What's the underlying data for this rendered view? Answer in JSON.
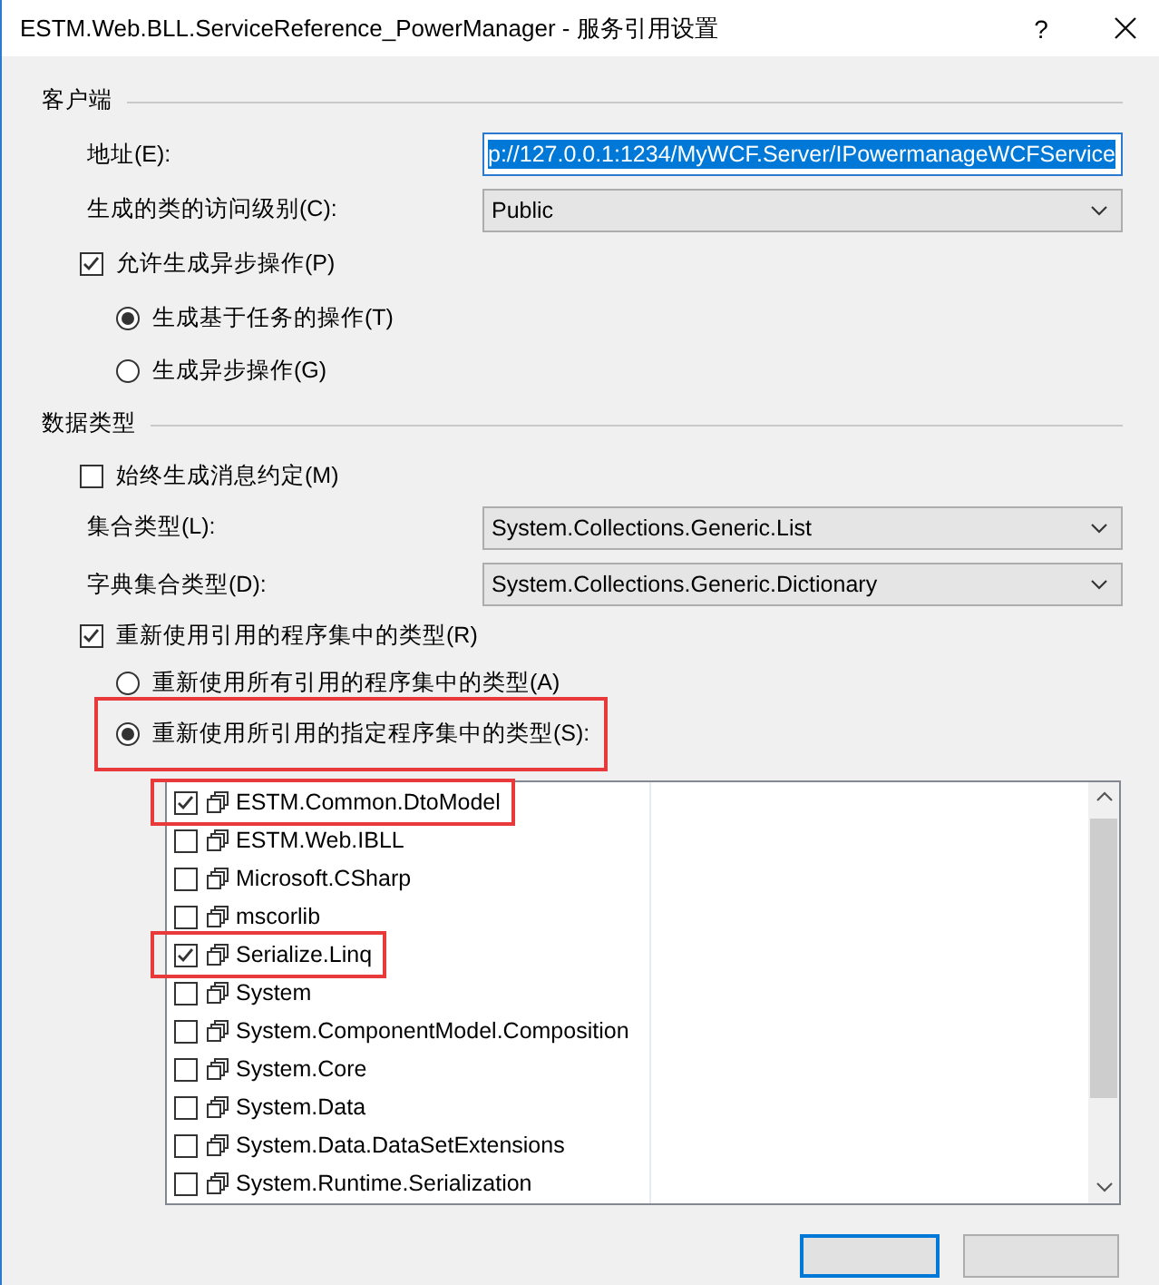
{
  "window": {
    "title": "ESTM.Web.BLL.ServiceReference_PowerManager - 服务引用设置",
    "help": "?"
  },
  "client": {
    "heading": "客户端",
    "address": {
      "label": "地址(E):",
      "value": "p://127.0.0.1:1234/MyWCF.Server/IPowermanageWCFService",
      "highlighted": true
    },
    "access_level": {
      "label": "生成的类的访问级别(C):",
      "value": "Public"
    },
    "async": {
      "label": "允许生成异步操作(P)",
      "checked": true
    },
    "async_modes": [
      {
        "label": "生成基于任务的操作(T)",
        "selected": true
      },
      {
        "label": "生成异步操作(G)",
        "selected": false
      }
    ]
  },
  "data_types": {
    "heading": "数据类型",
    "message_contracts": {
      "label": "始终生成消息约定(M)",
      "checked": false
    },
    "collection_type": {
      "label": "集合类型(L):",
      "value": "System.Collections.Generic.List"
    },
    "dictionary_type": {
      "label": "字典集合类型(D):",
      "value": "System.Collections.Generic.Dictionary"
    },
    "reuse_types": {
      "label": "重新使用引用的程序集中的类型(R)",
      "checked": true
    },
    "reuse_modes": [
      {
        "label": "重新使用所有引用的程序集中的类型(A)",
        "selected": false,
        "annotated": false
      },
      {
        "label": "重新使用所引用的指定程序集中的类型(S):",
        "selected": true,
        "annotated": true
      }
    ],
    "assemblies": [
      {
        "name": "ESTM.Common.DtoModel",
        "checked": true,
        "annotated": true
      },
      {
        "name": "ESTM.Web.IBLL",
        "checked": false,
        "annotated": false
      },
      {
        "name": "Microsoft.CSharp",
        "checked": false,
        "annotated": false
      },
      {
        "name": "mscorlib",
        "checked": false,
        "annotated": false
      },
      {
        "name": "Serialize.Linq",
        "checked": true,
        "annotated": true
      },
      {
        "name": "System",
        "checked": false,
        "annotated": false
      },
      {
        "name": "System.ComponentModel.Composition",
        "checked": false,
        "annotated": false
      },
      {
        "name": "System.Core",
        "checked": false,
        "annotated": false
      },
      {
        "name": "System.Data",
        "checked": false,
        "annotated": false
      },
      {
        "name": "System.Data.DataSetExtensions",
        "checked": false,
        "annotated": false
      },
      {
        "name": "System.Runtime.Serialization",
        "checked": false,
        "annotated": false
      }
    ]
  }
}
